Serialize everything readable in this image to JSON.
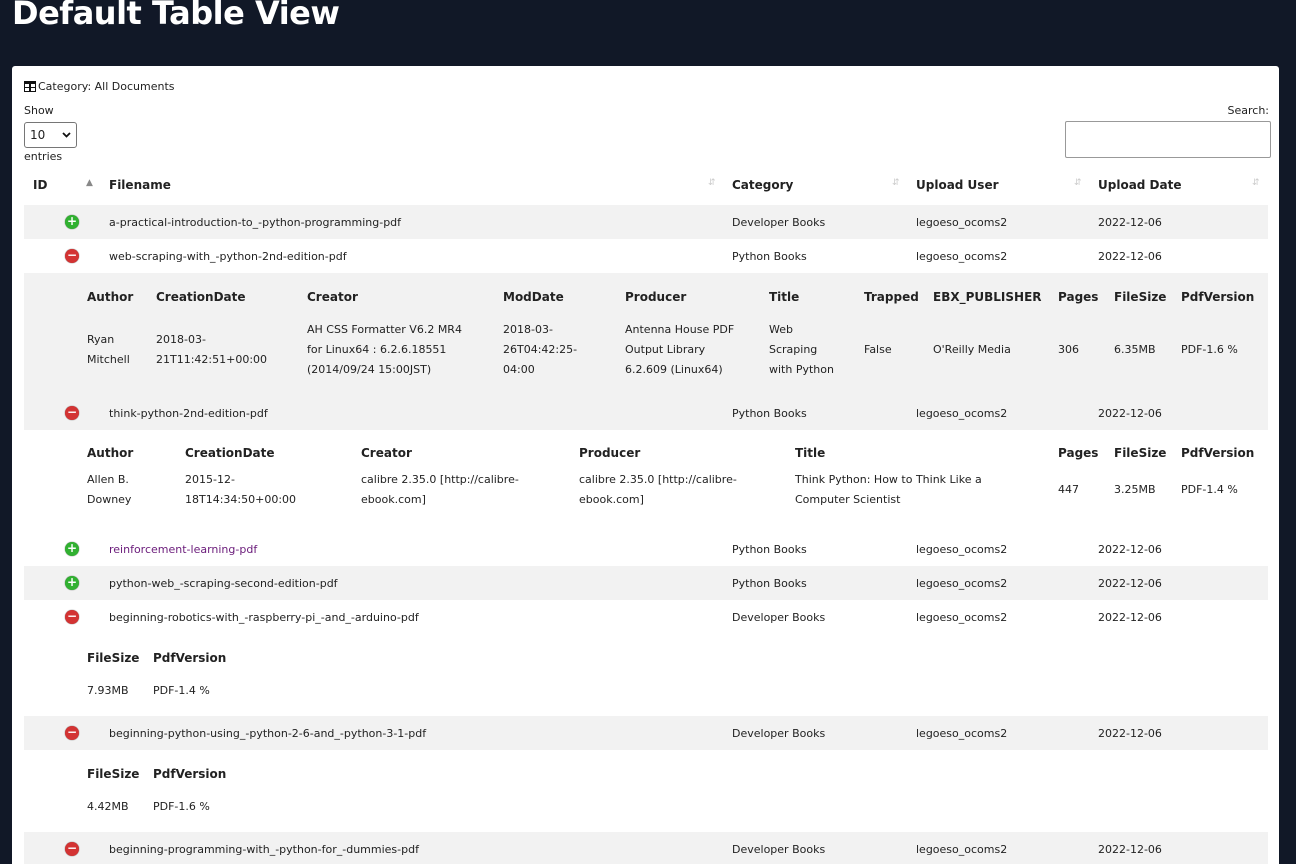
{
  "page": {
    "title": "Default Table View"
  },
  "toolbar": {
    "category_label": "Category: All Documents",
    "show_label": "Show",
    "entries_value": "10",
    "entries_label": "entries",
    "search_label": "Search:"
  },
  "table": {
    "headers": [
      "ID",
      "Filename",
      "Category",
      "Upload User",
      "Upload Date"
    ],
    "rows": [
      {
        "control": "+",
        "filename": "a-practical-introduction-to_-python-programming-pdf",
        "category": "Developer Books",
        "user": "legoeso_ocoms2",
        "date": "2022-12-06"
      },
      {
        "control": "−",
        "filename": "web-scraping-with_-python-2nd-edition-pdf",
        "category": "Python Books",
        "user": "legoeso_ocoms2",
        "date": "2022-12-06"
      },
      {
        "control": "−",
        "filename": "think-python-2nd-edition-pdf",
        "category": "Python Books",
        "user": "legoeso_ocoms2",
        "date": "2022-12-06"
      },
      {
        "control": "+",
        "filename": "reinforcement-learning-pdf",
        "category": "Python Books",
        "user": "legoeso_ocoms2",
        "date": "2022-12-06"
      },
      {
        "control": "+",
        "filename": "python-web_-scraping-second-edition-pdf",
        "category": "Python Books",
        "user": "legoeso_ocoms2",
        "date": "2022-12-06"
      },
      {
        "control": "−",
        "filename": "beginning-robotics-with_-raspberry-pi_-and_-arduino-pdf",
        "category": "Developer Books",
        "user": "legoeso_ocoms2",
        "date": "2022-12-06"
      },
      {
        "control": "−",
        "filename": "beginning-python-using_-python-2-6-and_-python-3-1-pdf",
        "category": "Developer Books",
        "user": "legoeso_ocoms2",
        "date": "2022-12-06"
      },
      {
        "control": "−",
        "filename": "beginning-programming-with_-python-for_-dummies-pdf",
        "category": "Developer Books",
        "user": "legoeso_ocoms2",
        "date": "2022-12-06"
      }
    ],
    "details": {
      "web_scraping": {
        "headers": [
          "Author",
          "CreationDate",
          "Creator",
          "ModDate",
          "Producer",
          "Title",
          "Trapped",
          "EBX_PUBLISHER",
          "Pages",
          "FileSize",
          "PdfVersion"
        ],
        "author": "Ryan\nMitchell",
        "creation_date": "2018-03-\n21T11:42:51+00:00",
        "creator": "AH CSS Formatter V6.2 MR4\nfor Linux64 : 6.2.6.18551\n(2014/09/24 15:00JST)",
        "mod_date": "2018-03-\n26T04:42:25-\n04:00",
        "producer": "Antenna House PDF\nOutput Library\n6.2.609 (Linux64)",
        "title": "Web\nScraping\nwith Python",
        "trapped": "False",
        "publisher": "O'Reilly Media",
        "pages": "306",
        "filesize": "6.35MB",
        "pdfversion": "PDF-1.6 %"
      },
      "think_python": {
        "headers": [
          "Author",
          "CreationDate",
          "Creator",
          "Producer",
          "Title",
          "Pages",
          "FileSize",
          "PdfVersion"
        ],
        "author": "Allen B.\nDowney",
        "creation_date": "2015-12-\n18T14:34:50+00:00",
        "creator": "calibre 2.35.0 [http://calibre-\nebook.com]",
        "producer": "calibre 2.35.0 [http://calibre-\nebook.com]",
        "title": "Think Python: How to Think Like a\nComputer Scientist",
        "pages": "447",
        "filesize": "3.25MB",
        "pdfversion": "PDF-1.4 %"
      },
      "robotics": {
        "headers": [
          "FileSize",
          "PdfVersion"
        ],
        "filesize": "7.93MB",
        "pdfversion": "PDF-1.4 %"
      },
      "beginning_python": {
        "headers": [
          "FileSize",
          "PdfVersion"
        ],
        "filesize": "4.42MB",
        "pdfversion": "PDF-1.6 %"
      }
    }
  }
}
